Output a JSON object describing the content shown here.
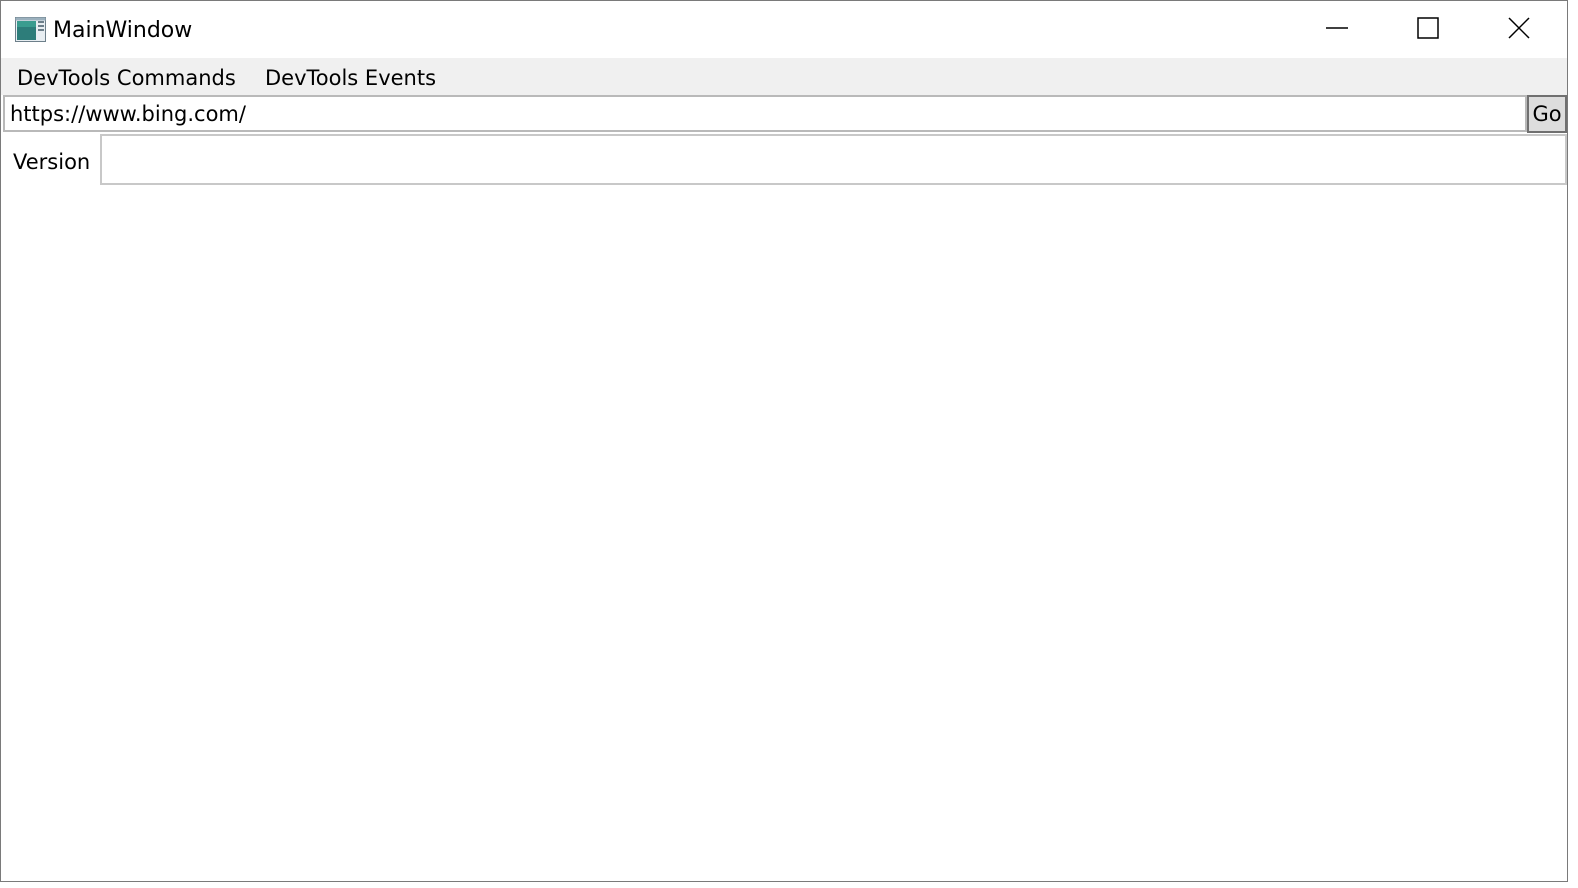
{
  "window": {
    "title": "MainWindow",
    "icon": "app-window-icon",
    "controls": {
      "minimize_icon": "minimize-icon",
      "maximize_icon": "maximize-icon",
      "close_icon": "close-icon"
    }
  },
  "menubar": {
    "items": [
      {
        "label": "DevTools Commands"
      },
      {
        "label": "DevTools Events"
      }
    ]
  },
  "address": {
    "value": "https://www.bing.com/",
    "go_label": "Go"
  },
  "version": {
    "label": "Version",
    "value": ""
  },
  "colors": {
    "menubar_bg": "#f0f0f0",
    "go_button_bg": "#dddddd",
    "border": "#7a7a7a"
  }
}
